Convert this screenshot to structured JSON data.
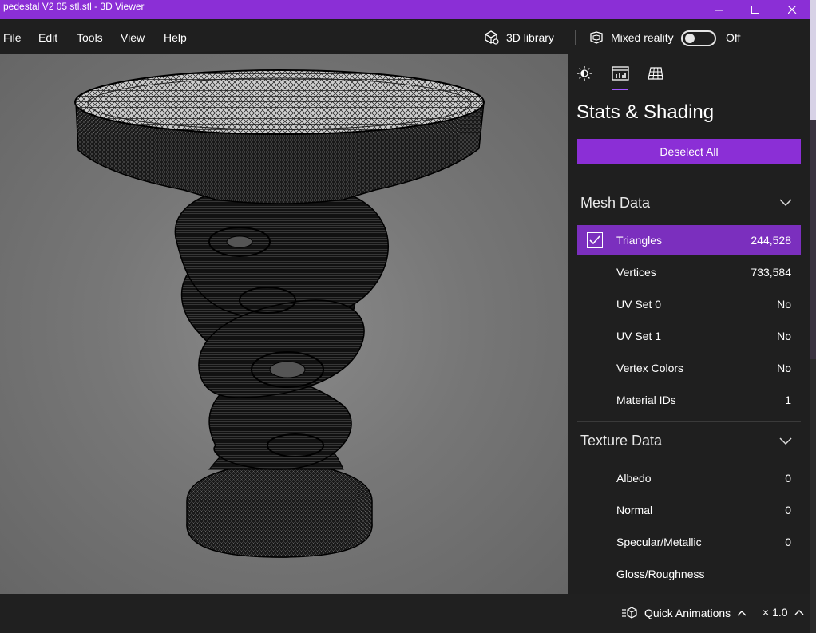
{
  "window": {
    "title": "pedestal V2 05 stl.stl - 3D Viewer"
  },
  "menu": {
    "items": [
      "File",
      "Edit",
      "Tools",
      "View",
      "Help"
    ]
  },
  "toolbar": {
    "library_label": "3D library",
    "mixed_reality_label": "Mixed reality",
    "mixed_reality_state": "Off",
    "mixed_reality_on": false
  },
  "panel": {
    "title": "Stats & Shading",
    "deselect_label": "Deselect All",
    "tabs": [
      "sun-icon",
      "stats-icon",
      "grid-icon"
    ],
    "active_tab": 1,
    "mesh_section": {
      "title": "Mesh Data",
      "rows": [
        {
          "label": "Triangles",
          "value": "244,528",
          "checked": true
        },
        {
          "label": "Vertices",
          "value": "733,584"
        },
        {
          "label": "UV Set 0",
          "value": "No"
        },
        {
          "label": "UV Set 1",
          "value": "No"
        },
        {
          "label": "Vertex Colors",
          "value": "No"
        },
        {
          "label": "Material IDs",
          "value": "1"
        }
      ]
    },
    "texture_section": {
      "title": "Texture Data",
      "rows": [
        {
          "label": "Albedo",
          "value": "0"
        },
        {
          "label": "Normal",
          "value": "0"
        },
        {
          "label": "Specular/Metallic",
          "value": "0"
        },
        {
          "label": "Gloss/Roughness",
          "value": ""
        }
      ]
    }
  },
  "bottom": {
    "quick_animations_label": "Quick Animations",
    "speed_label": "× 1.0"
  },
  "colors": {
    "accent": "#8b2fd6",
    "selected_row": "#7b2fbe",
    "panel_bg": "#1f1f1f"
  }
}
